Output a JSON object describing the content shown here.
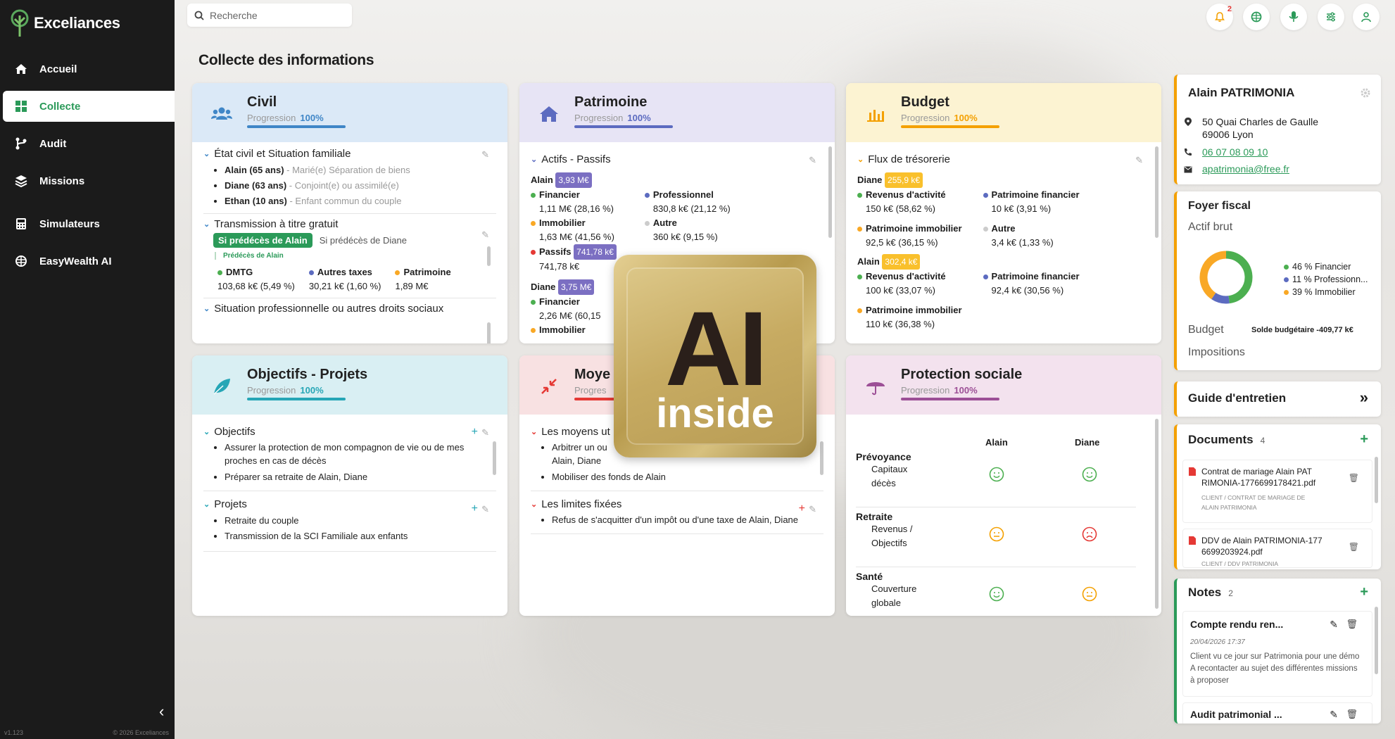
{
  "app": {
    "name": "Exceliances",
    "version": "v1.123",
    "copyright": "© 2026 Exceliances"
  },
  "nav": [
    {
      "label": "Accueil"
    },
    {
      "label": "Collecte"
    },
    {
      "label": "Audit"
    },
    {
      "label": "Missions"
    },
    {
      "label": "Simulateurs"
    },
    {
      "label": "EasyWealth AI"
    }
  ],
  "search": {
    "placeholder": "Recherche"
  },
  "notifications": {
    "count": "2"
  },
  "page": {
    "title": "Collecte des informations"
  },
  "civil": {
    "title": "Civil",
    "progress_label": "Progression",
    "progress": "100%",
    "sec1": "État civil et Situation familiale",
    "people": [
      {
        "name": "Alain (65 ans)",
        "desc": "- Marié(e) Séparation de biens"
      },
      {
        "name": "Diane (63 ans)",
        "desc": "- Conjoint(e) ou assimilé(e)"
      },
      {
        "name": "Ethan (10 ans)",
        "desc": "- Enfant commun du couple"
      }
    ],
    "sec2": "Transmission à titre gratuit",
    "tab_active": "Si prédécès de Alain",
    "tab_other": "Si prédécès de Diane",
    "sub": "Prédécès de Alain",
    "dmtg": "DMTG",
    "dmtg_val": "103,68 k€ (5,49 %)",
    "autres": "Autres taxes",
    "autres_val": "30,21 k€ (1,60 %)",
    "patri": "Patrimoine",
    "patri_val": "1,89 M€",
    "sec3": "Situation professionnelle ou autres droits sociaux"
  },
  "patrimoine": {
    "title": "Patrimoine",
    "progress_label": "Progression",
    "progress": "100%",
    "sec1": "Actifs - Passifs",
    "alain": "Alain",
    "alain_total": "3,93 M€",
    "fin": "Financier",
    "fin_val": "1,11 M€ (28,16 %)",
    "pro": "Professionnel",
    "pro_val": "830,8 k€ (21,12 %)",
    "immo": "Immobilier",
    "immo_val": "1,63 M€ (41,56 %)",
    "autre": "Autre",
    "autre_val": "360 k€ (9,15 %)",
    "passifs": "Passifs",
    "passifs_val": "741,78 k€",
    "passifs_val2": "741,78 k€",
    "diane": "Diane",
    "diane_total": "3,75 M€",
    "dfin": "Financier",
    "dfin_val": "2,26 M€ (60,15",
    "dimmo": "Immobilier"
  },
  "budget": {
    "title": "Budget",
    "progress_label": "Progression",
    "progress": "100%",
    "sec1": "Flux de trésorerie",
    "diane": "Diane",
    "diane_total": "255,9 k€",
    "d_rev": "Revenus d'activité",
    "d_rev_val": "150 k€ (58,62 %)",
    "d_pf": "Patrimoine financier",
    "d_pf_val": "10 k€ (3,91 %)",
    "d_pi": "Patrimoine immobilier",
    "d_pi_val": "92,5 k€ (36,15 %)",
    "d_autre": "Autre",
    "d_autre_val": "3,4 k€ (1,33 %)",
    "alain": "Alain",
    "alain_total": "302,4 k€",
    "a_rev": "Revenus d'activité",
    "a_rev_val": "100 k€ (33,07 %)",
    "a_pf": "Patrimoine financier",
    "a_pf_val": "92,4 k€ (30,56 %)",
    "a_pi": "Patrimoine immobilier",
    "a_pi_val": "110 k€ (36,38 %)"
  },
  "objectifs": {
    "title": "Objectifs - Projets",
    "progress_label": "Progression",
    "progress": "100%",
    "sec1": "Objectifs",
    "obj": [
      "Assurer la protection de mon compagnon de vie ou de mes proches en cas de décès",
      "Préparer sa retraite de Alain, Diane"
    ],
    "sec2": "Projets",
    "proj": [
      "Retraite du couple",
      "Transmission de la SCI Familiale aux enfants"
    ]
  },
  "moyens": {
    "title": "Moye",
    "progress_label": "Progres",
    "sec1": "Les moyens ut",
    "items": [
      "Arbitrer un ou",
      "Alain, Diane",
      "Mobiliser des fonds de Alain"
    ],
    "sec2": "Les limites fixées",
    "limits": [
      "Refus de s'acquitter d'un impôt ou d'une taxe de Alain, Diane"
    ]
  },
  "protection": {
    "title": "Protection sociale",
    "progress_label": "Progression",
    "progress": "100%",
    "col1": "Alain",
    "col2": "Diane",
    "rows": [
      {
        "cat": "Prévoyance",
        "sub": "Capitaux décès"
      },
      {
        "cat": "Retraite",
        "sub": "Revenus / Objectifs"
      },
      {
        "cat": "Santé",
        "sub": "Couverture globale"
      }
    ]
  },
  "client": {
    "name": "Alain PATRIMONIA",
    "address1": "50 Quai Charles de Gaulle",
    "address2": "69006 Lyon",
    "phone": "06 07 08 09 10",
    "email": "apatrimonia@free.fr"
  },
  "foyer": {
    "title": "Foyer fiscal",
    "actif": "Actif brut",
    "legend": [
      "46 % Financier",
      "11 % Professionn...",
      "39 % Immobilier"
    ],
    "budget": "Budget",
    "solde": "Solde budgétaire -409,77 k€",
    "impositions": "Impositions"
  },
  "guide": {
    "title": "Guide d'entretien"
  },
  "documents": {
    "title": "Documents",
    "count": "4",
    "items": [
      {
        "name1": "Contrat de mariage Alain PAT",
        "name2": "RIMONIA-1776699178421.pdf",
        "path1": "CLIENT / CONTRAT DE MARIAGE DE",
        "path2": "ALAIN PATRIMONIA"
      },
      {
        "name1": "DDV de Alain PATRIMONIA-177",
        "name2": "6699203924.pdf",
        "path1": "CLIENT / DDV PATRIMONIA",
        "path2": ""
      }
    ]
  },
  "notes": {
    "title": "Notes",
    "count": "2",
    "items": [
      {
        "title": "Compte rendu ren...",
        "date": "20/04/2026 17:37",
        "text": "Client vu ce jour sur Patrimonia pour une démo A recontacter au sujet des différentes missions à proposer"
      },
      {
        "title": "Audit patrimonial ..."
      }
    ]
  },
  "ai_badge": {
    "big": "AI",
    "small": "inside"
  },
  "chart_data": {
    "type": "pie",
    "categories": [
      "Financier",
      "Professionnel",
      "Immobilier"
    ],
    "values": [
      46,
      11,
      39
    ],
    "colors": [
      "#4caf50",
      "#5c6bc0",
      "#f9a825"
    ]
  }
}
